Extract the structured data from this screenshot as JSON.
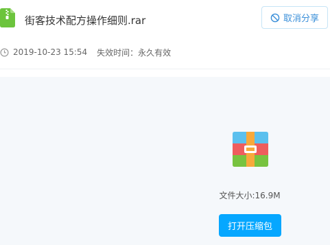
{
  "file": {
    "name": "街客技术配方操作细则.rar",
    "icon": "zip-file-icon"
  },
  "header": {
    "cancel_share_label": "取消分享",
    "cancel_share_icon": "prohibit-icon"
  },
  "meta": {
    "date": "2019-10-23 15:54",
    "expiry": "失效时间：永久有效",
    "clock_icon": "clock-icon"
  },
  "preview": {
    "archive_icon": "archive-icon",
    "size_text": "文件大小:16.9M",
    "open_button_label": "打开压缩包"
  },
  "colors": {
    "accent": "#06a7ff",
    "link": "#3a8fd9",
    "file_icon_green": "#6cc43d",
    "panel_background": "#f5f8fb"
  }
}
